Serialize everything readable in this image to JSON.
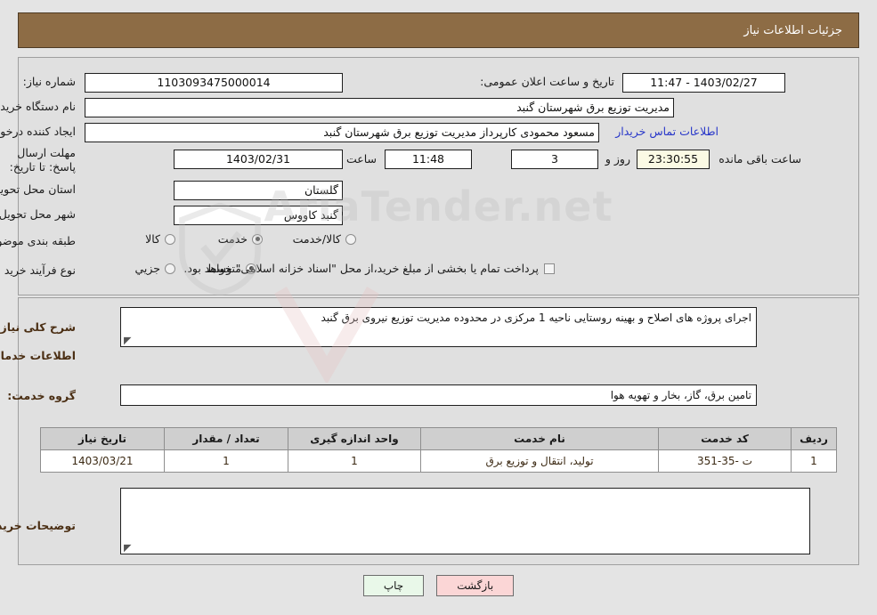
{
  "header": {
    "title": "جزئیات اطلاعات نیاز"
  },
  "watermark": {
    "text": "AriaTender.net"
  },
  "form": {
    "need_number_label": "شماره نیاز:",
    "need_number_value": "1103093475000014",
    "announce_label": "تاریخ و ساعت اعلان عمومی:",
    "announce_value": "1403/02/27 - 11:47",
    "buyer_org_label": "نام دستگاه خریدار:",
    "buyer_org_value": "مدیریت توزیع برق شهرستان گنبد",
    "creator_label": "ایجاد کننده درخواست:",
    "creator_value": "مسعود محمودی کارپرداز مدیریت توزیع برق شهرستان گنبد",
    "buyer_contact_link": "اطلاعات تماس خریدار",
    "deadline_label": "مهلت ارسال پاسخ: تا تاریخ:",
    "deadline_date": "1403/02/31",
    "deadline_hour_label": "ساعت",
    "deadline_hour": "11:48",
    "remaining_days": "3",
    "remaining_days_label": "روز و",
    "remaining_time": "23:30:55",
    "remaining_suffix": "ساعت باقی مانده",
    "province_label": "استان محل تحویل:",
    "province_value": "گلستان",
    "city_label": "شهر محل تحویل:",
    "city_value": "گنبد کاووس",
    "category_label": "طبقه بندی موضوعی:",
    "category_options": [
      {
        "label": "کالا",
        "selected": false
      },
      {
        "label": "خدمت",
        "selected": true
      },
      {
        "label": "کالا/خدمت",
        "selected": false
      }
    ],
    "process_label": "نوع فرآیند خرید :",
    "process_options": [
      {
        "label": "جزیي",
        "selected": false
      },
      {
        "label": "متوسط",
        "selected": true
      }
    ],
    "treasury_checkbox_label": "پرداخت تمام یا بخشی از مبلغ خرید،از محل \"اسناد خزانه اسلامی\" خواهد بود.",
    "treasury_checked": false
  },
  "description": {
    "label": "شرح کلی نیاز:",
    "value": "اجرای پروژه های اصلاح و بهینه روستایی ناحیه 1 مرکزی در محدوده مدیریت توزیع نیروی برق گنبد"
  },
  "services_section": {
    "heading": "اطلاعات خدمات مورد نیاز",
    "group_label": "گروه خدمت:",
    "group_value": "تامین برق، گاز، بخار و تهویه هوا"
  },
  "table": {
    "columns": [
      "ردیف",
      "کد خدمت",
      "نام خدمت",
      "واحد اندازه گیری",
      "تعداد / مقدار",
      "تاریخ نیاز"
    ],
    "rows": [
      [
        "1",
        "ت -35-351",
        "تولید، انتقال و توزیع برق",
        "1",
        "1",
        "1403/03/21"
      ]
    ]
  },
  "buyer_notes": {
    "label": "توضیحات خریدار:",
    "value": ""
  },
  "footer": {
    "back_label": "بازگشت",
    "print_label": "چاپ"
  },
  "colors": {
    "header_bg": "#8d6c45",
    "panel_bg": "#e0e0e0",
    "page_bg": "#e4e4e4",
    "link": "#2736c9",
    "section_title": "#4b2f14",
    "back_btn": "#fbd6d6",
    "print_btn": "#e9f8e9",
    "countdown_bg": "#fbfae4"
  }
}
